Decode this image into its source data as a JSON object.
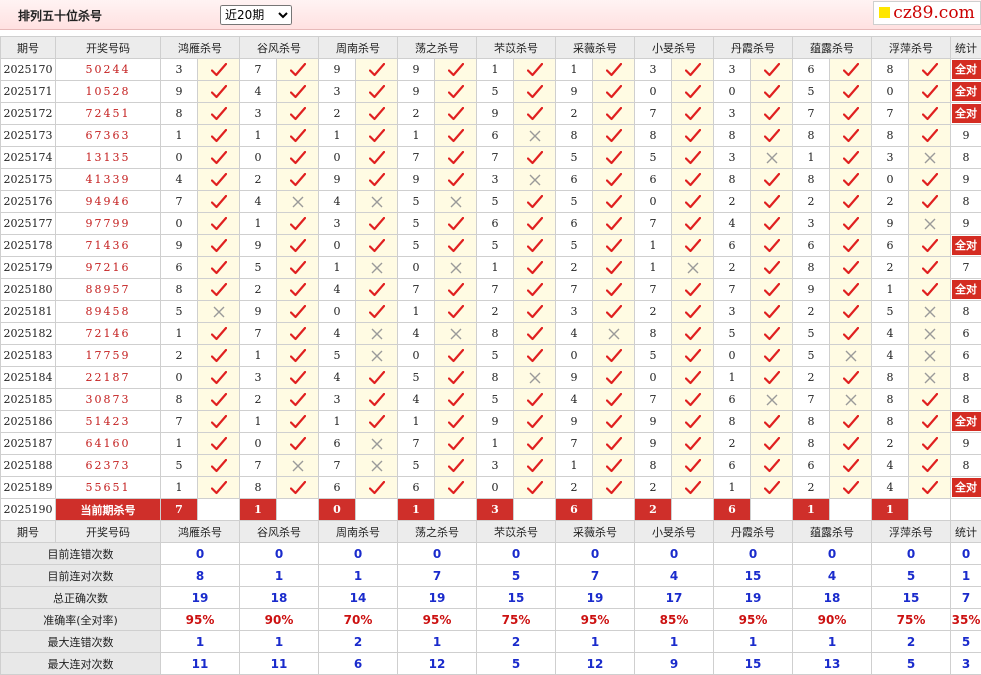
{
  "page": {
    "title": "排列五十位杀号",
    "period_select": "近20期",
    "logo": "cz89.com"
  },
  "header": {
    "period": "期号",
    "numbers": "开奖号码",
    "experts": [
      "鸿雁杀号",
      "谷风杀号",
      "周南杀号",
      "荡之杀号",
      "芣苡杀号",
      "采薇杀号",
      "小旻杀号",
      "丹霞杀号",
      "蕴露杀号",
      "浮萍杀号"
    ],
    "stat": "统计"
  },
  "rows": [
    {
      "p": "2025170",
      "n": "50244",
      "v": [
        "3",
        "7",
        "9",
        "9",
        "1",
        "1",
        "3",
        "3",
        "6",
        "8"
      ],
      "m": "1111111111",
      "s": "全对"
    },
    {
      "p": "2025171",
      "n": "10528",
      "v": [
        "9",
        "4",
        "3",
        "9",
        "5",
        "9",
        "0",
        "0",
        "5",
        "0"
      ],
      "m": "1111111111",
      "s": "全对"
    },
    {
      "p": "2025172",
      "n": "72451",
      "v": [
        "8",
        "3",
        "2",
        "2",
        "9",
        "2",
        "7",
        "3",
        "7",
        "7"
      ],
      "m": "1111111111",
      "s": "全对"
    },
    {
      "p": "2025173",
      "n": "67363",
      "v": [
        "1",
        "1",
        "1",
        "1",
        "6",
        "8",
        "8",
        "8",
        "8",
        "8"
      ],
      "m": "1111011111",
      "s": "9"
    },
    {
      "p": "2025174",
      "n": "13135",
      "v": [
        "0",
        "0",
        "0",
        "7",
        "7",
        "5",
        "5",
        "3",
        "1",
        "3"
      ],
      "m": "1111111010",
      "s": "8"
    },
    {
      "p": "2025175",
      "n": "41339",
      "v": [
        "4",
        "2",
        "9",
        "9",
        "3",
        "6",
        "6",
        "8",
        "8",
        "0"
      ],
      "m": "1111011111",
      "s": "9"
    },
    {
      "p": "2025176",
      "n": "94946",
      "v": [
        "7",
        "4",
        "4",
        "5",
        "5",
        "5",
        "0",
        "2",
        "2",
        "2"
      ],
      "m": "1000111111",
      "s": "8"
    },
    {
      "p": "2025177",
      "n": "97799",
      "v": [
        "0",
        "1",
        "3",
        "5",
        "6",
        "6",
        "7",
        "4",
        "3",
        "9"
      ],
      "m": "1111111110",
      "s": "9"
    },
    {
      "p": "2025178",
      "n": "71436",
      "v": [
        "9",
        "9",
        "0",
        "5",
        "5",
        "5",
        "1",
        "6",
        "6",
        "6"
      ],
      "m": "1111111111",
      "s": "全对"
    },
    {
      "p": "2025179",
      "n": "97216",
      "v": [
        "6",
        "5",
        "1",
        "0",
        "1",
        "2",
        "1",
        "2",
        "8",
        "2"
      ],
      "m": "1100110111",
      "s": "7"
    },
    {
      "p": "2025180",
      "n": "88957",
      "v": [
        "8",
        "2",
        "4",
        "7",
        "7",
        "7",
        "7",
        "7",
        "9",
        "1"
      ],
      "m": "1111111111",
      "s": "全对"
    },
    {
      "p": "2025181",
      "n": "89458",
      "v": [
        "5",
        "9",
        "0",
        "1",
        "2",
        "3",
        "2",
        "3",
        "2",
        "5"
      ],
      "m": "0111111110",
      "s": "8"
    },
    {
      "p": "2025182",
      "n": "72146",
      "v": [
        "1",
        "7",
        "4",
        "4",
        "8",
        "4",
        "8",
        "5",
        "5",
        "4"
      ],
      "m": "1100101110",
      "s": "6"
    },
    {
      "p": "2025183",
      "n": "17759",
      "v": [
        "2",
        "1",
        "5",
        "0",
        "5",
        "0",
        "5",
        "0",
        "5",
        "4"
      ],
      "m": "1101111100",
      "s": "6"
    },
    {
      "p": "2025184",
      "n": "22187",
      "v": [
        "0",
        "3",
        "4",
        "5",
        "8",
        "9",
        "0",
        "1",
        "2",
        "8"
      ],
      "m": "1111011110",
      "s": "8"
    },
    {
      "p": "2025185",
      "n": "30873",
      "v": [
        "8",
        "2",
        "3",
        "4",
        "5",
        "4",
        "7",
        "6",
        "7",
        "8"
      ],
      "m": "1111111001",
      "s": "8"
    },
    {
      "p": "2025186",
      "n": "51423",
      "v": [
        "7",
        "1",
        "1",
        "1",
        "9",
        "9",
        "9",
        "8",
        "8",
        "8"
      ],
      "m": "1111111111",
      "s": "全对"
    },
    {
      "p": "2025187",
      "n": "64160",
      "v": [
        "1",
        "0",
        "6",
        "7",
        "1",
        "7",
        "9",
        "2",
        "8",
        "2"
      ],
      "m": "1101111111",
      "s": "9"
    },
    {
      "p": "2025188",
      "n": "62373",
      "v": [
        "5",
        "7",
        "7",
        "5",
        "3",
        "1",
        "8",
        "6",
        "6",
        "4"
      ],
      "m": "1001111111",
      "s": "8"
    },
    {
      "p": "2025189",
      "n": "55651",
      "v": [
        "1",
        "8",
        "6",
        "6",
        "0",
        "2",
        "2",
        "1",
        "2",
        "4"
      ],
      "m": "1111111111",
      "s": "全对"
    }
  ],
  "current": {
    "p": "2025190",
    "label": "当前期杀号",
    "v": [
      "7",
      "1",
      "0",
      "1",
      "3",
      "6",
      "2",
      "6",
      "1",
      "1"
    ]
  },
  "summary": [
    {
      "label": "目前连错次数",
      "v": [
        "0",
        "0",
        "0",
        "0",
        "0",
        "0",
        "0",
        "0",
        "0",
        "0"
      ],
      "s": "0",
      "color": "blue"
    },
    {
      "label": "目前连对次数",
      "v": [
        "8",
        "1",
        "1",
        "7",
        "5",
        "7",
        "4",
        "15",
        "4",
        "5"
      ],
      "s": "1",
      "color": "blue"
    },
    {
      "label": "总正确次数",
      "v": [
        "19",
        "18",
        "14",
        "19",
        "15",
        "19",
        "17",
        "19",
        "18",
        "15"
      ],
      "s": "7",
      "color": "blue"
    },
    {
      "label": "准确率(全对率)",
      "v": [
        "95%",
        "90%",
        "70%",
        "95%",
        "75%",
        "95%",
        "85%",
        "95%",
        "90%",
        "75%"
      ],
      "s": "35%",
      "color": "red"
    },
    {
      "label": "最大连错次数",
      "v": [
        "1",
        "1",
        "2",
        "1",
        "2",
        "1",
        "1",
        "1",
        "1",
        "2"
      ],
      "s": "5",
      "color": "blue"
    },
    {
      "label": "最大连对次数",
      "v": [
        "11",
        "11",
        "6",
        "12",
        "5",
        "12",
        "9",
        "15",
        "13",
        "5"
      ],
      "s": "3",
      "color": "blue"
    }
  ]
}
